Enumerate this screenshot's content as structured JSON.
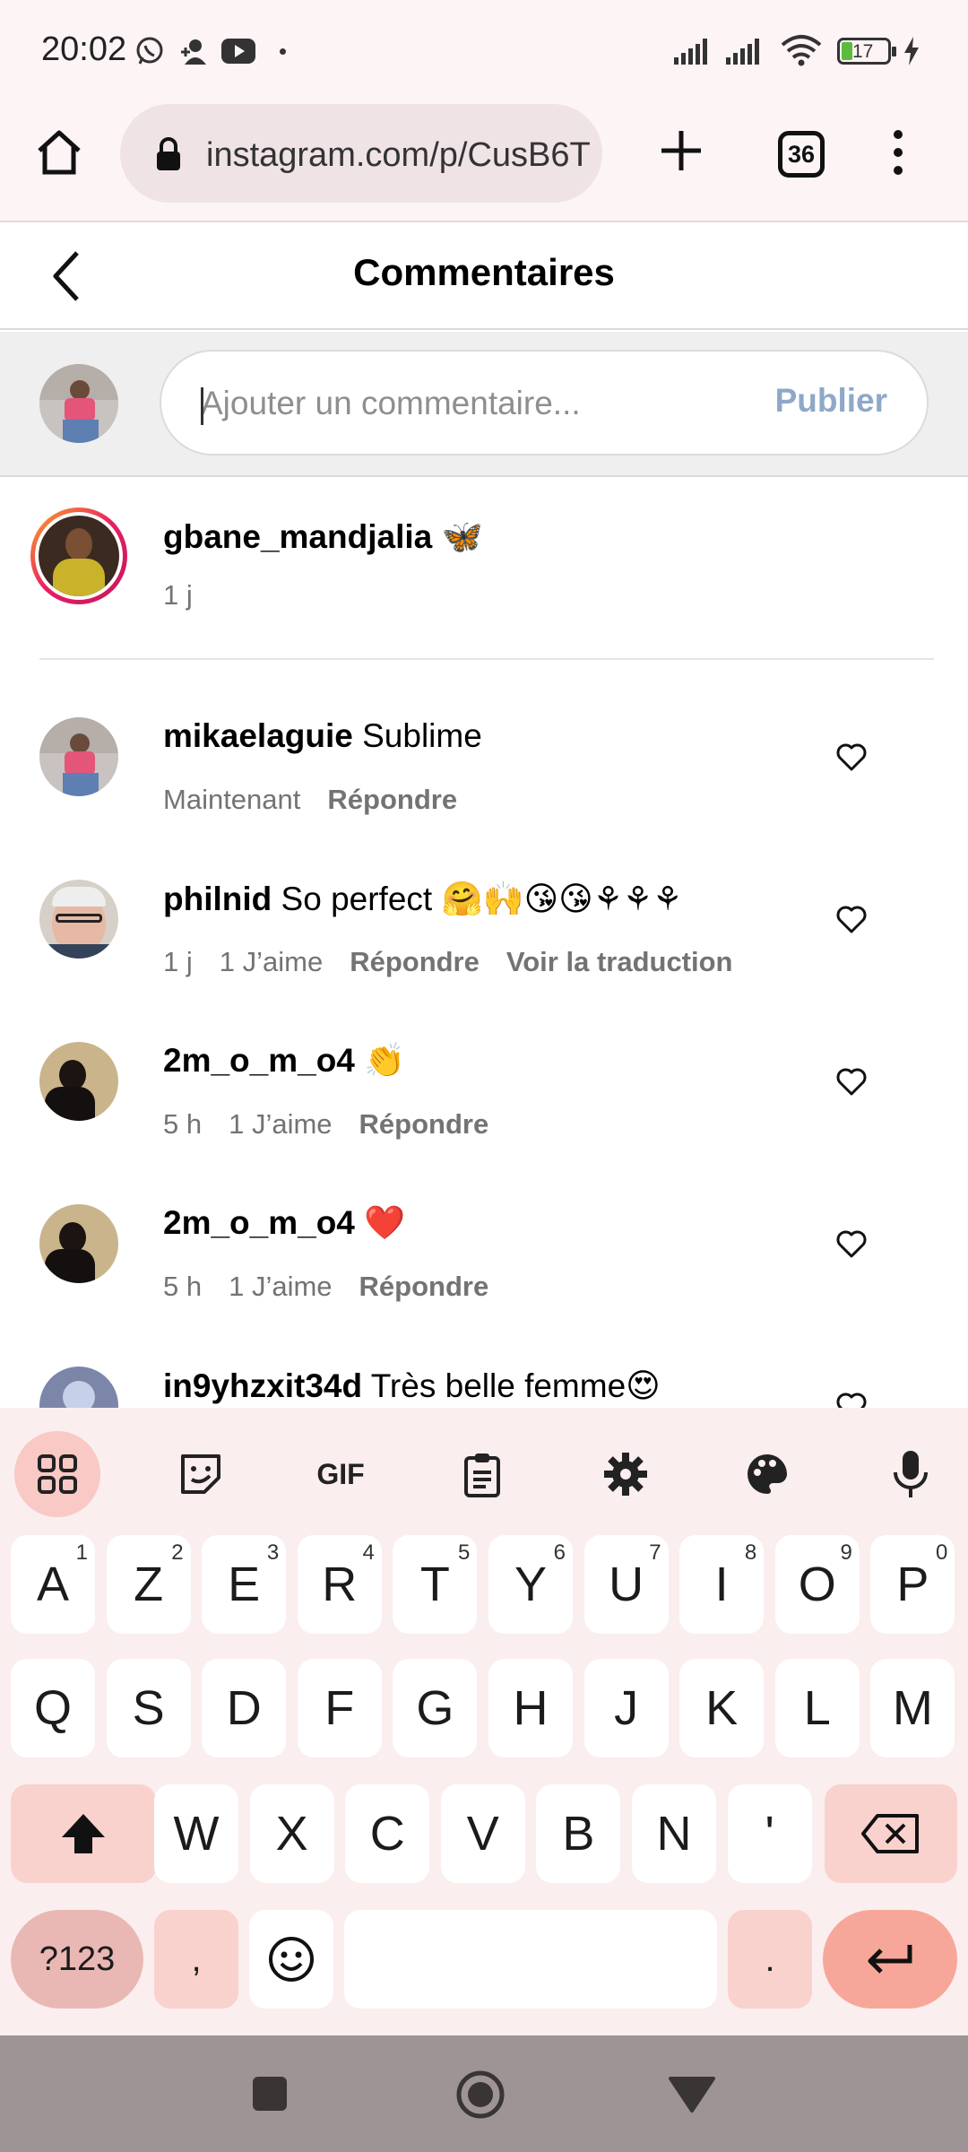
{
  "status_bar": {
    "time": "20:02",
    "battery": "17"
  },
  "browser": {
    "url": "instagram.com/p/CusB6T",
    "tab_count": "36"
  },
  "header": {
    "title": "Commentaires"
  },
  "comment_input": {
    "placeholder": "Ajouter un commentaire...",
    "publish_label": "Publier"
  },
  "caption": {
    "username": "gbane_mandjalia",
    "text": "🦋",
    "time": "1 j"
  },
  "comments": [
    {
      "username": "mikaelaguie",
      "text": "Sublime",
      "time": "Maintenant",
      "likes": "",
      "reply": "Répondre",
      "translate": ""
    },
    {
      "username": "philnid",
      "text": "So perfect 🤗🙌😘😘⚘⚘⚘",
      "time": "1 j",
      "likes": "1 J’aime",
      "reply": "Répondre",
      "translate": "Voir la traduction"
    },
    {
      "username": "2m_o_m_o4",
      "text": "👏",
      "time": "5 h",
      "likes": "1 J’aime",
      "reply": "Répondre",
      "translate": ""
    },
    {
      "username": "2m_o_m_o4",
      "text": "❤️",
      "time": "5 h",
      "likes": "1 J’aime",
      "reply": "Répondre",
      "translate": ""
    },
    {
      "username": "in9yhzxit34d",
      "text": "Très belle femme😍",
      "time": "",
      "likes": "",
      "reply": "",
      "translate": ""
    }
  ],
  "keyboard": {
    "toolbar": [
      "apps-grid-icon",
      "sticker-icon",
      "GIF",
      "clipboard-icon",
      "settings-icon",
      "palette-icon",
      "mic-icon"
    ],
    "row1": [
      [
        "A",
        "1"
      ],
      [
        "Z",
        "2"
      ],
      [
        "E",
        "3"
      ],
      [
        "R",
        "4"
      ],
      [
        "T",
        "5"
      ],
      [
        "Y",
        "6"
      ],
      [
        "U",
        "7"
      ],
      [
        "I",
        "8"
      ],
      [
        "O",
        "9"
      ],
      [
        "P",
        "0"
      ]
    ],
    "row2": [
      "Q",
      "S",
      "D",
      "F",
      "G",
      "H",
      "J",
      "K",
      "L",
      "M"
    ],
    "row3": [
      "W",
      "X",
      "C",
      "V",
      "B",
      "N",
      "'"
    ],
    "num_key": "?123",
    "comma": ",",
    "period": "."
  },
  "colors": {
    "accent_publish": "#8ea8c7",
    "keyboard_bg": "#fbeeee",
    "enter_key": "#f7a799",
    "story_ring_start": "#f9a825",
    "story_ring_end": "#c2185b"
  }
}
